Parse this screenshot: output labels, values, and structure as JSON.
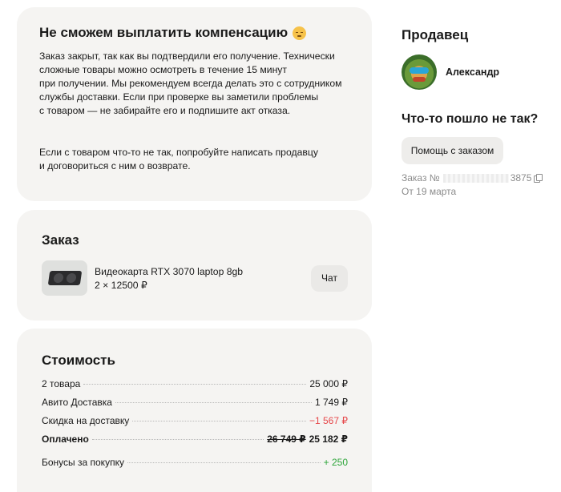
{
  "refund": {
    "title": "Не сможем выплатить компенсацию",
    "emoji": "pensive-face",
    "paragraph1": "Заказ закрыт, так как вы подтвердили его получение. Технически\nсложные товары можно осмотреть в течение 15 минут\nпри получении. Мы рекомендуем всегда делать это с сотрудником\nслужбы доставки. Если при проверке вы заметили проблемы\nс товаром — не забирайте его и подпишите акт отказа.",
    "paragraph2": "Если с товаром что-то не так, попробуйте написать продавцу\nи договориться с ним о возврате."
  },
  "order": {
    "title": "Заказ",
    "item_name": "Видеокарта RTX 3070 laptop 8gb",
    "item_qty": "2 × 12500 ₽",
    "chat_label": "Чат"
  },
  "cost": {
    "title": "Стоимость",
    "rows": [
      {
        "label": "2 товара",
        "value": "25 000 ₽"
      },
      {
        "label": "Авито Доставка",
        "value": "1 749 ₽"
      },
      {
        "label": "Скидка на доставку",
        "value": "−1 567 ₽"
      }
    ],
    "paid_label": "Оплачено",
    "paid_old": "26 749 ₽",
    "paid_new": "25 182 ₽",
    "bonus_label": "Бонусы за покупку",
    "bonus_value": "+ 250",
    "colors": {
      "discount": "#e6474a",
      "bonus": "#2da53a"
    }
  },
  "seller": {
    "title": "Продавец",
    "name": "Александр"
  },
  "support": {
    "title": "Что-то пошло не так?",
    "help_label": "Помощь с заказом",
    "order_prefix": "Заказ №",
    "order_suffix": "3875",
    "date": "От 19 марта"
  }
}
